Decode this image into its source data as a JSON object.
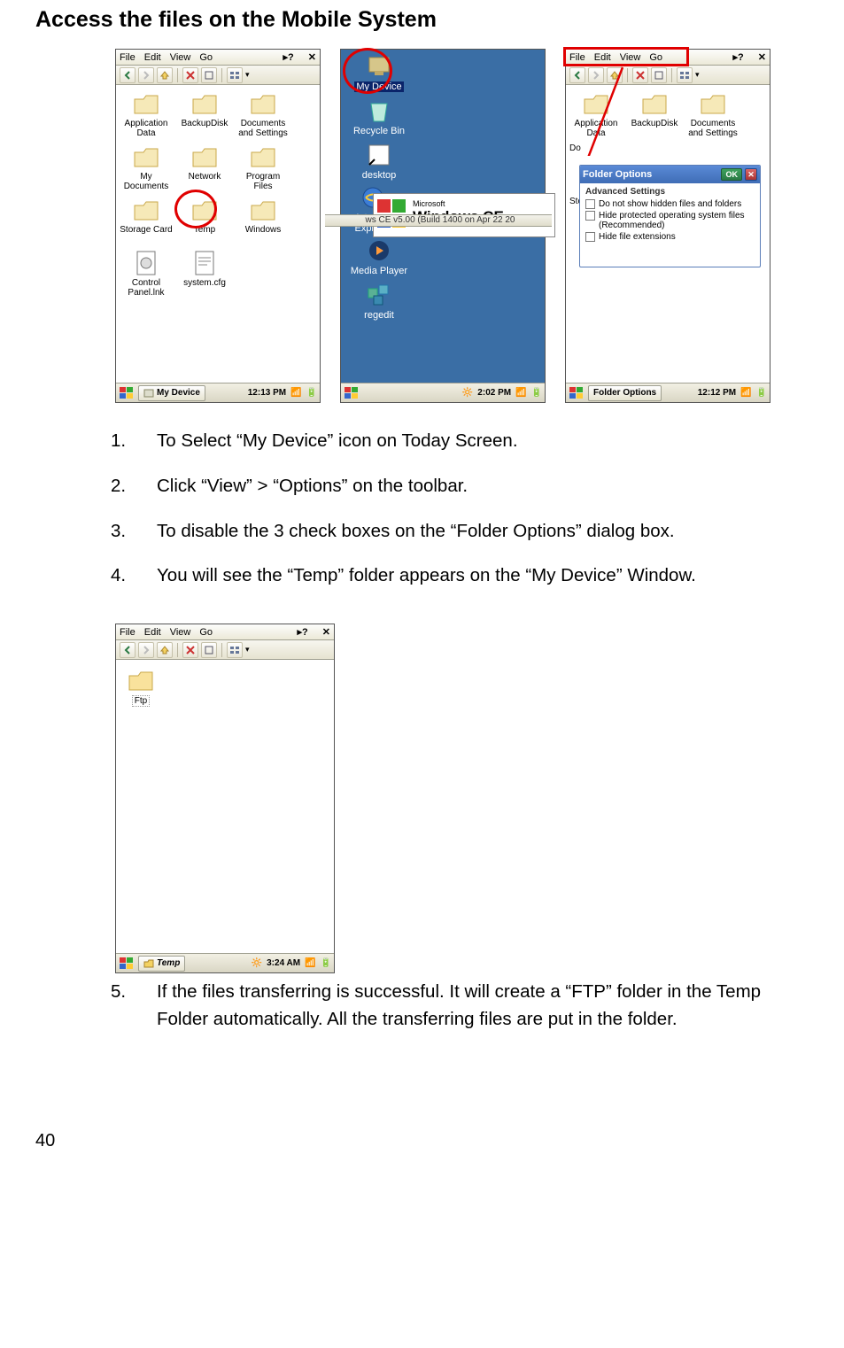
{
  "heading": "Access the files on the Mobile System",
  "menus": {
    "file": "File",
    "edit": "Edit",
    "view": "View",
    "go": "Go"
  },
  "shotA": {
    "icons": [
      {
        "label": "Application Data"
      },
      {
        "label": "BackupDisk"
      },
      {
        "label": "Documents and Settings"
      },
      {
        "label": "My Documents"
      },
      {
        "label": "Network"
      },
      {
        "label": "Program Files"
      },
      {
        "label": "Storage Card"
      },
      {
        "label": "Temp"
      },
      {
        "label": "Windows"
      },
      {
        "label": "Control Panel.lnk"
      },
      {
        "label": "system.cfg"
      }
    ],
    "task": "My Device",
    "time": "12:13 PM"
  },
  "shotB": {
    "icons": [
      {
        "label": "My Device",
        "sel": true
      },
      {
        "label": "Recycle Bin"
      },
      {
        "label": "desktop"
      },
      {
        "label": "Internet Explorer"
      },
      {
        "label": "Media Player"
      },
      {
        "label": "regedit"
      }
    ],
    "ce_text": "Windows CE",
    "ce_brand": "Microsoft",
    "ce_build": "ws CE v5.00 (Build 1400 on Apr 22 20",
    "time": "2:02 PM"
  },
  "shotC": {
    "icons": [
      "Application Data",
      "BackupDisk",
      "Documents and Settings"
    ],
    "icons2": [
      "Do",
      "Sto"
    ],
    "dialog_title": "Folder Options",
    "adv": "Advanced Settings",
    "opts": [
      "Do not show hidden files and folders",
      "Hide protected operating system files (Recommended)",
      "Hide file extensions"
    ],
    "ok": "OK",
    "task": "Folder Options",
    "time": "12:12 PM"
  },
  "shotD": {
    "ftp": "Ftp",
    "task": "Temp",
    "time": "3:24 AM"
  },
  "steps": [
    "To Select “My Device” icon on Today Screen.",
    "Click “View” > “Options” on the toolbar.",
    "To disable the 3 check boxes on the “Folder Options” dialog box.",
    "You will see the “Temp” folder appears on the “My Device” Window.",
    "If the files transferring is successful. It will create a “FTP” folder in the Temp Folder automatically. All the transferring files are put in the folder."
  ],
  "page": "40"
}
